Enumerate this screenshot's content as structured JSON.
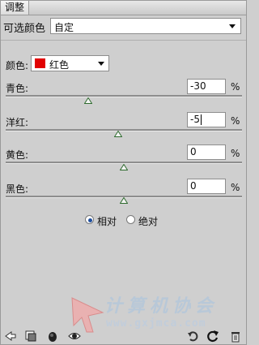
{
  "panel": {
    "tab_title": "调整"
  },
  "preset": {
    "label": "可选颜色",
    "value": "自定"
  },
  "colors": {
    "label": "颜色:",
    "value": "红色",
    "swatch_color": "#e10000"
  },
  "sliders": [
    {
      "key": "cyan",
      "label": "青色:",
      "value": "-30",
      "unit": "%",
      "level": -30
    },
    {
      "key": "magenta",
      "label": "洋红:",
      "value": "-5",
      "unit": "%",
      "level": -5
    },
    {
      "key": "yellow",
      "label": "黄色:",
      "value": "0",
      "unit": "%",
      "level": 0
    },
    {
      "key": "black",
      "label": "黑色:",
      "value": "0",
      "unit": "%",
      "level": 0
    }
  ],
  "method": {
    "relative": "相对",
    "absolute": "绝对",
    "selected": "relative"
  },
  "watermark": {
    "title": "计算机协会",
    "url": "www.gxjmca.com"
  },
  "toolbar_icons": [
    "back-arrow-icon",
    "clip-layer-icon",
    "visibility-mask-icon",
    "eye-icon",
    "view-previous-icon",
    "reset-icon",
    "trash-icon"
  ]
}
